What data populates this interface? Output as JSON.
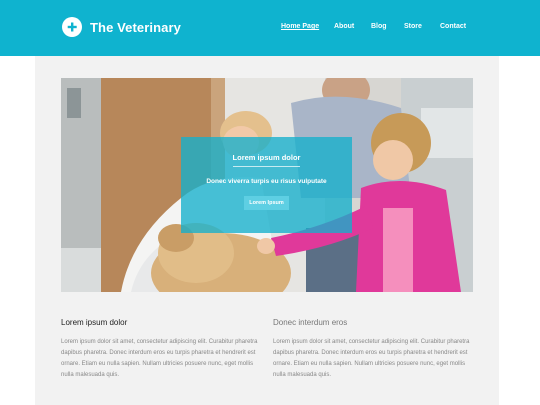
{
  "brand": {
    "name": "The Veterinary",
    "accent": "#0fb3cf"
  },
  "nav": {
    "items": [
      {
        "label": "Home Page",
        "active": true
      },
      {
        "label": "About",
        "active": false
      },
      {
        "label": "Blog",
        "active": false
      },
      {
        "label": "Store",
        "active": false
      },
      {
        "label": "Contact",
        "active": false
      }
    ]
  },
  "hero": {
    "title": "Lorem ipsum dolor",
    "subtitle": "Donec viverra turpis eu risus vulputate",
    "button_label": "Lorem Ipsum"
  },
  "columns": [
    {
      "title": "Lorem ipsum dolor",
      "text": "Lorem ipsum dolor sit amet, consectetur adipiscing elit. Curabitur pharetra dapibus pharetra. Donec interdum eros eu turpis pharetra et hendrerit est ornare. Etiam eu nulla sapien. Nullam ultricies posuere nunc, eget mollis nulla malesuada quis."
    },
    {
      "title": "Donec interdum eros",
      "text": "Lorem ipsum dolor sit amet, consectetur adipiscing elit. Curabitur pharetra dapibus pharetra. Donec interdum eros eu turpis pharetra et hendrerit est ornare. Etiam eu nulla sapien. Nullam ultricies posuere nunc, eget mollis nulla malesuada quis."
    }
  ]
}
